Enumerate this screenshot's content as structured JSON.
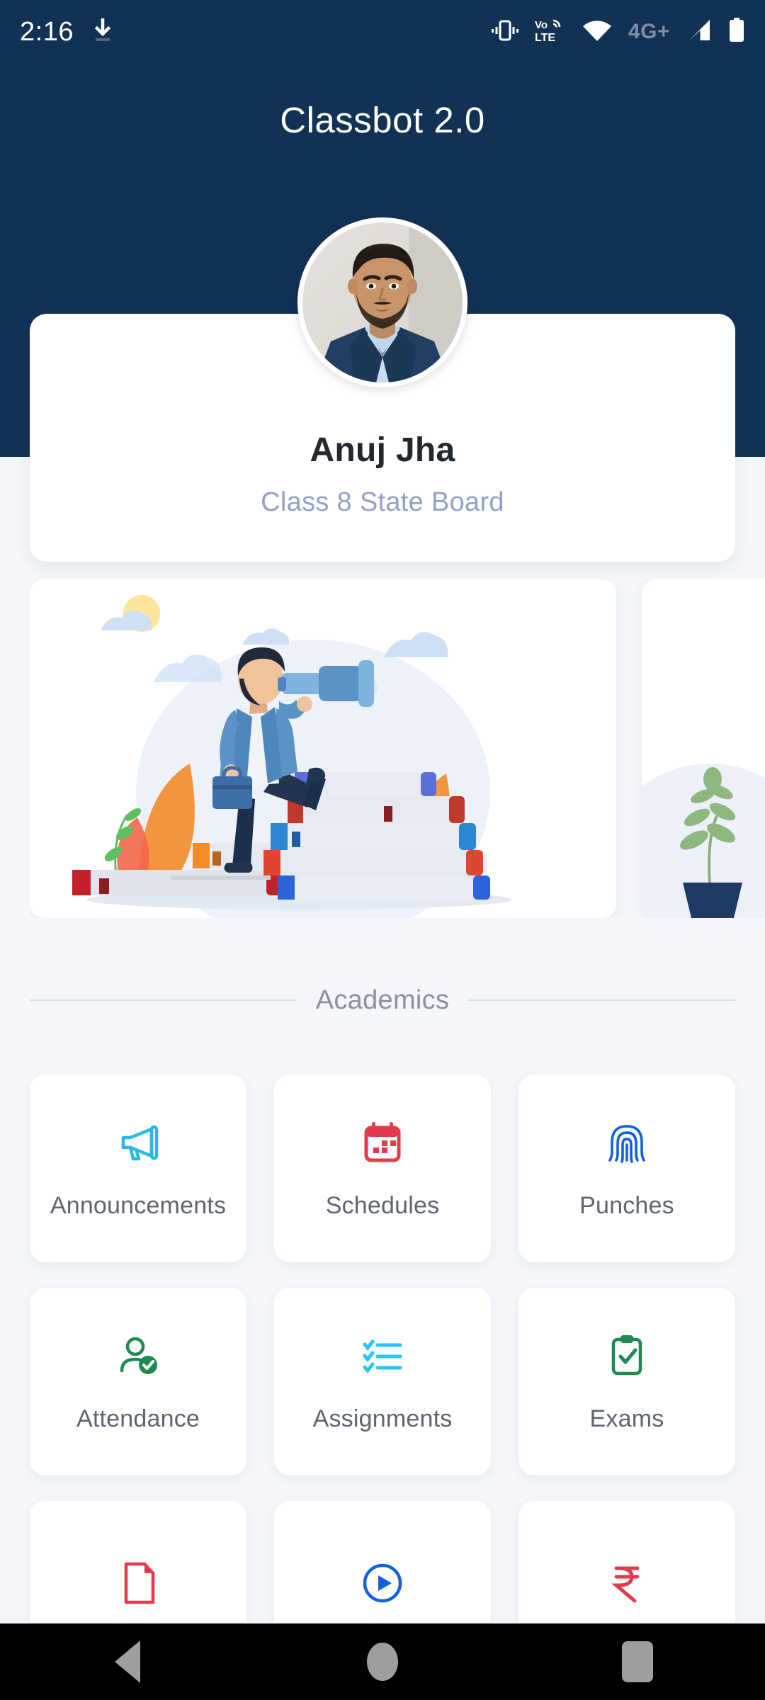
{
  "status_bar": {
    "time": "2:16",
    "download_icon": "download-icon",
    "icons": [
      "vibrate-icon",
      "volte-icon",
      "wifi-icon",
      "4g-plus-label",
      "signal-bars-icon",
      "battery-icon"
    ],
    "network_label": "4G+",
    "volte_top": "Vo",
    "volte_bottom": "LTE"
  },
  "header": {
    "title": "Classbot 2.0",
    "background_color": "#123255"
  },
  "profile": {
    "avatar_alt": "student-profile-photo",
    "name": "Anuj Jha",
    "subtitle": "Class 8 State Board"
  },
  "carousel": {
    "banners": [
      {
        "alt": "man-with-telescope-on-books-illustration"
      },
      {
        "alt": "potted-plant-illustration"
      }
    ]
  },
  "section": {
    "title": "Academics"
  },
  "grid": {
    "tiles": [
      {
        "label": "Announcements",
        "icon": "megaphone-icon",
        "color": "#2BB7E8"
      },
      {
        "label": "Schedules",
        "icon": "calendar-icon",
        "color": "#E33B4B"
      },
      {
        "label": "Punches",
        "icon": "fingerprint-icon",
        "color": "#1161E0"
      },
      {
        "label": "Attendance",
        "icon": "person-check-icon",
        "color": "#1E8A52"
      },
      {
        "label": "Assignments",
        "icon": "checklist-icon",
        "color": "#2BC4F0"
      },
      {
        "label": "Exams",
        "icon": "clipboard-check-icon",
        "color": "#1E8A52"
      },
      {
        "label": "",
        "icon": "pdf-document-icon",
        "color": "#E33B4B"
      },
      {
        "label": "",
        "icon": "play-circle-icon",
        "color": "#1161E0"
      },
      {
        "label": "",
        "icon": "rupee-icon",
        "color": "#E33B4B"
      }
    ]
  },
  "navbar": {
    "back": "back-button",
    "home": "home-button",
    "recents": "recents-button"
  },
  "colors": {
    "background": "#F4F6FA",
    "header": "#123255",
    "card": "#FFFFFF",
    "subtitle": "#93A1C4"
  }
}
